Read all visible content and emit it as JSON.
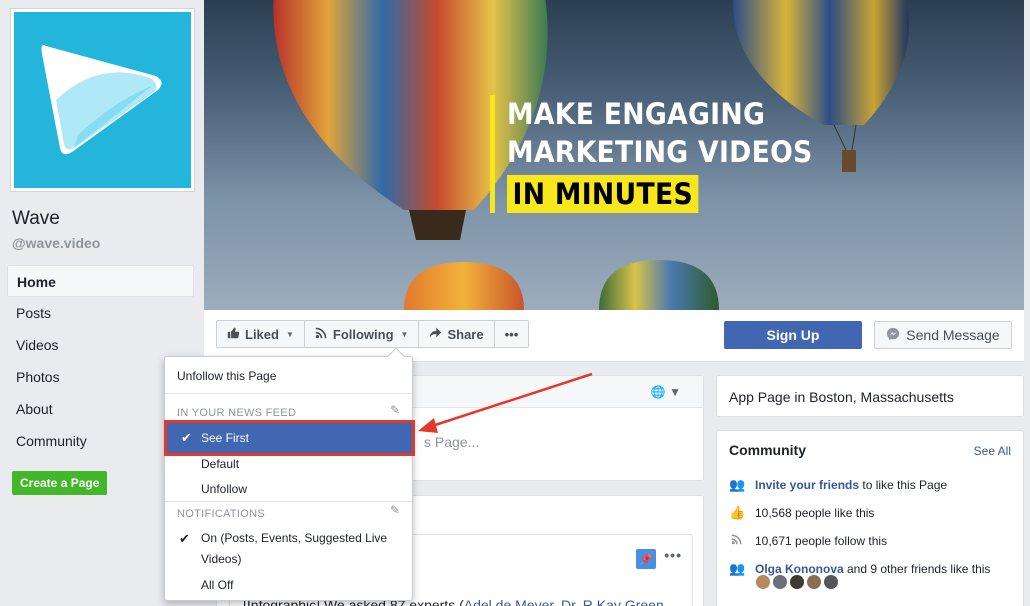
{
  "page": {
    "name": "Wave",
    "handle": "@wave.video"
  },
  "sidebar": {
    "items": [
      {
        "label": "Home"
      },
      {
        "label": "Posts"
      },
      {
        "label": "Videos"
      },
      {
        "label": "Photos"
      },
      {
        "label": "About"
      },
      {
        "label": "Community"
      }
    ],
    "create_label": "Create a Page"
  },
  "cover": {
    "line1": "MAKE ENGAGING",
    "line2": "MARKETING VIDEOS",
    "line3": "IN MINUTES"
  },
  "actions": {
    "liked": "Liked",
    "following": "Following",
    "share": "Share",
    "more": "•••",
    "signup": "Sign Up",
    "send_message": "Send Message"
  },
  "dropdown": {
    "unfollow_page": "Unfollow this Page",
    "news_feed_header": "IN YOUR NEWS FEED",
    "see_first": "See First",
    "default": "Default",
    "unfollow": "Unfollow",
    "notifications_header": "NOTIFICATIONS",
    "on_line1": "On (Posts, Events, Suggested Live",
    "on_line2": "Videos)",
    "all_off": "All Off"
  },
  "composer": {
    "placeholder_fragment": "s Page..."
  },
  "post": {
    "text_prefix": "[Infographic] We asked 87 experts (",
    "text_links": "Adel de Meyer, Dr. R Kay Green"
  },
  "about": {
    "category": "App Page in Boston, Massachusetts"
  },
  "community": {
    "title": "Community",
    "see_all": "See All",
    "invite_link": "Invite your friends",
    "invite_suffix": " to like this Page",
    "likes": "10,568 people like this",
    "follows": "10,671 people follow this",
    "friend_link": "Olga Kononova",
    "friend_suffix": " and 9 other friends like this"
  },
  "colors": {
    "brand": "#4267b2",
    "create": "#42b72a",
    "logo_bg": "#23b5db",
    "highlight": "#f8e71c",
    "annotation": "#e3382c"
  }
}
